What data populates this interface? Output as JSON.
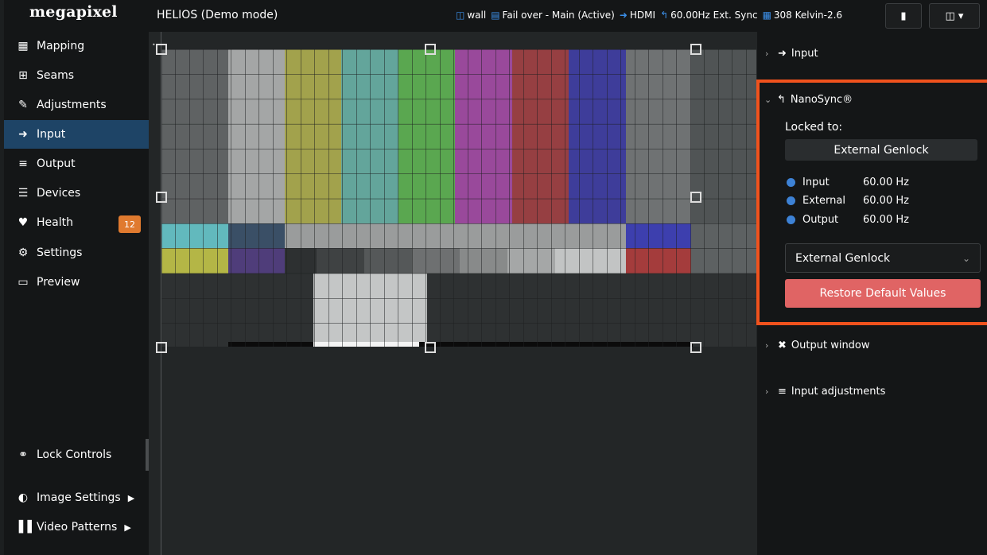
{
  "brand": "megapixel",
  "app_title": "HELIOS (Demo mode)",
  "status": {
    "wall": "wall",
    "failover": "Fail over - Main (Active)",
    "input": "HDMI",
    "sync": "60.00Hz Ext. Sync",
    "kelvin": "308 Kelvin-2.6"
  },
  "top_buttons": {
    "chat_icon": "chat-icon",
    "storage_icon": "database-icon"
  },
  "sidebar": {
    "items": [
      {
        "label": "Mapping",
        "icon": "grid-icon"
      },
      {
        "label": "Seams",
        "icon": "plus-square-icon"
      },
      {
        "label": "Adjustments",
        "icon": "brush-icon"
      },
      {
        "label": "Input",
        "icon": "input-icon"
      },
      {
        "label": "Output",
        "icon": "sliders-icon"
      },
      {
        "label": "Devices",
        "icon": "list-icon"
      },
      {
        "label": "Health",
        "icon": "heartbeat-icon"
      },
      {
        "label": "Settings",
        "icon": "gears-icon"
      },
      {
        "label": "Preview",
        "icon": "monitor-icon"
      }
    ],
    "health_badge": "12",
    "lock_controls": "Lock Controls",
    "image_settings": "Image Settings",
    "video_patterns": "Video Patterns"
  },
  "right_panel": {
    "input": "Input",
    "nanosync": "NanoSync®",
    "locked_to": "Locked to:",
    "locked_value": "External Genlock",
    "rates": [
      {
        "label": "Input",
        "value": "60.00 Hz"
      },
      {
        "label": "External",
        "value": "60.00 Hz"
      },
      {
        "label": "Output",
        "value": "60.00 Hz"
      }
    ],
    "select_value": "External Genlock",
    "restore": "Restore Default Values",
    "output_window": "Output window",
    "input_adjustments": "Input adjustments"
  },
  "colors": {
    "accent": "#f0521d",
    "active_nav": "#1e4466",
    "badge": "#e07a2f",
    "restore": "#e06464",
    "status_dot": "#3d82d6"
  }
}
